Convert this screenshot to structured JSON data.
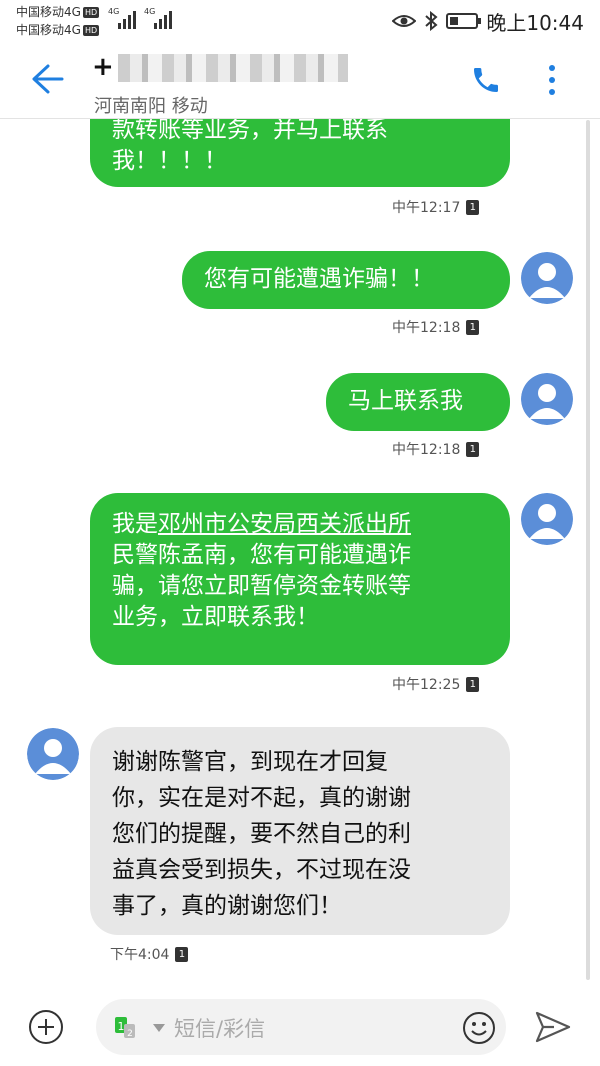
{
  "status_bar": {
    "carrier1": "中国移动4G",
    "carrier2": "中国移动4G",
    "hd": "HD",
    "net1": "4G",
    "net2": "4G",
    "clock": "晚上10:44",
    "battery_level": 0.35
  },
  "header": {
    "number_prefix": "+",
    "location": "河南南阳 移动"
  },
  "messages": [
    {
      "lines": [
        "款转账等业务，并马上联系",
        "我！！！！"
      ],
      "time": "中午12:17",
      "sim": "1"
    },
    {
      "text": "您有可能遭遇诈骗！！",
      "time": "中午12:18",
      "sim": "1"
    },
    {
      "text": "马上联系我",
      "time": "中午12:18",
      "sim": "1"
    },
    {
      "prefix": "我是",
      "link": "邓州市公安局西关派出所",
      "lines": [
        "民警陈孟南，您有可能遭遇诈",
        "骗，请您立即暂停资金转账等",
        "业务，立即联系我！"
      ],
      "time": "中午12:25",
      "sim": "1"
    },
    {
      "lines": [
        "谢谢陈警官，到现在才回复",
        "你，实在是对不起，真的谢谢",
        "您们的提醒，要不然自己的利",
        "益真会受到损失，不过现在没",
        "事了，真的谢谢您们！"
      ],
      "time": "下午4:04",
      "sim": "1"
    }
  ],
  "input": {
    "placeholder": "短信/彩信",
    "sim1": "1",
    "sim2": "2"
  },
  "colors": {
    "accent": "#1f7fe0",
    "outgoing_bubble": "#2ebd3a",
    "incoming_bubble": "#e7e7e7",
    "avatar": "#5b8ed8"
  }
}
